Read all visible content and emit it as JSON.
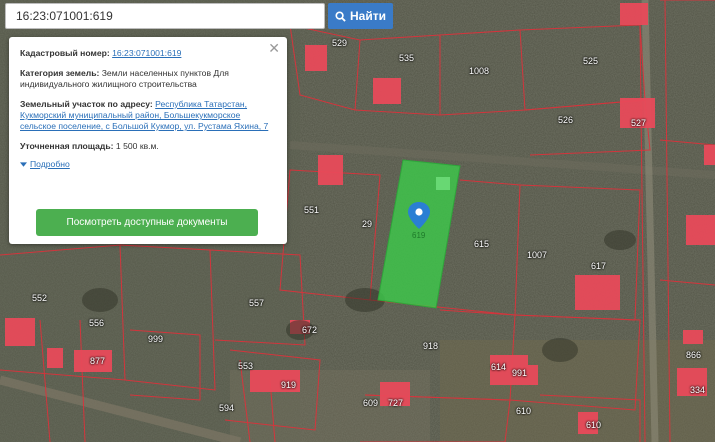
{
  "search": {
    "value": "16:23:071001:619",
    "button_label": "Найти"
  },
  "info_card": {
    "cadastral_label": "Кадастровый номер:",
    "cadastral_number": "16:23:071001:619",
    "category_label": "Категория земель:",
    "category_value": "Земли населенных пунктов Для индивидуального жилищного строительства",
    "address_label": "Земельный участок по адресу:",
    "address_value": "Республика Татарстан, Кукморский муниципальный район, Большекукморское сельское поселение, с Большой Кукмор, ул. Рустама Яхина, 7",
    "area_label": "Уточненная площадь:",
    "area_value": "1 500 кв.м.",
    "details_label": "Подробно",
    "docs_button": "Посмотреть доступные документы"
  },
  "map": {
    "parcel_labels": [
      "529",
      "535",
      "1008",
      "525",
      "526",
      "527",
      "551",
      "29",
      "615",
      "1007",
      "617",
      "552",
      "556",
      "557",
      "553",
      "999",
      "877",
      "918",
      "614",
      "991",
      "609",
      "727",
      "610",
      "594",
      "919",
      "672",
      "334",
      "866",
      "610"
    ],
    "marker_label": "619",
    "colors": {
      "selected_parcel": "#3ccb4a",
      "boundary": "#e0303a",
      "building": "#e84a5a",
      "search_button": "#3a7bc8",
      "docs_button": "#4caf50",
      "link": "#2a6fb8"
    }
  }
}
